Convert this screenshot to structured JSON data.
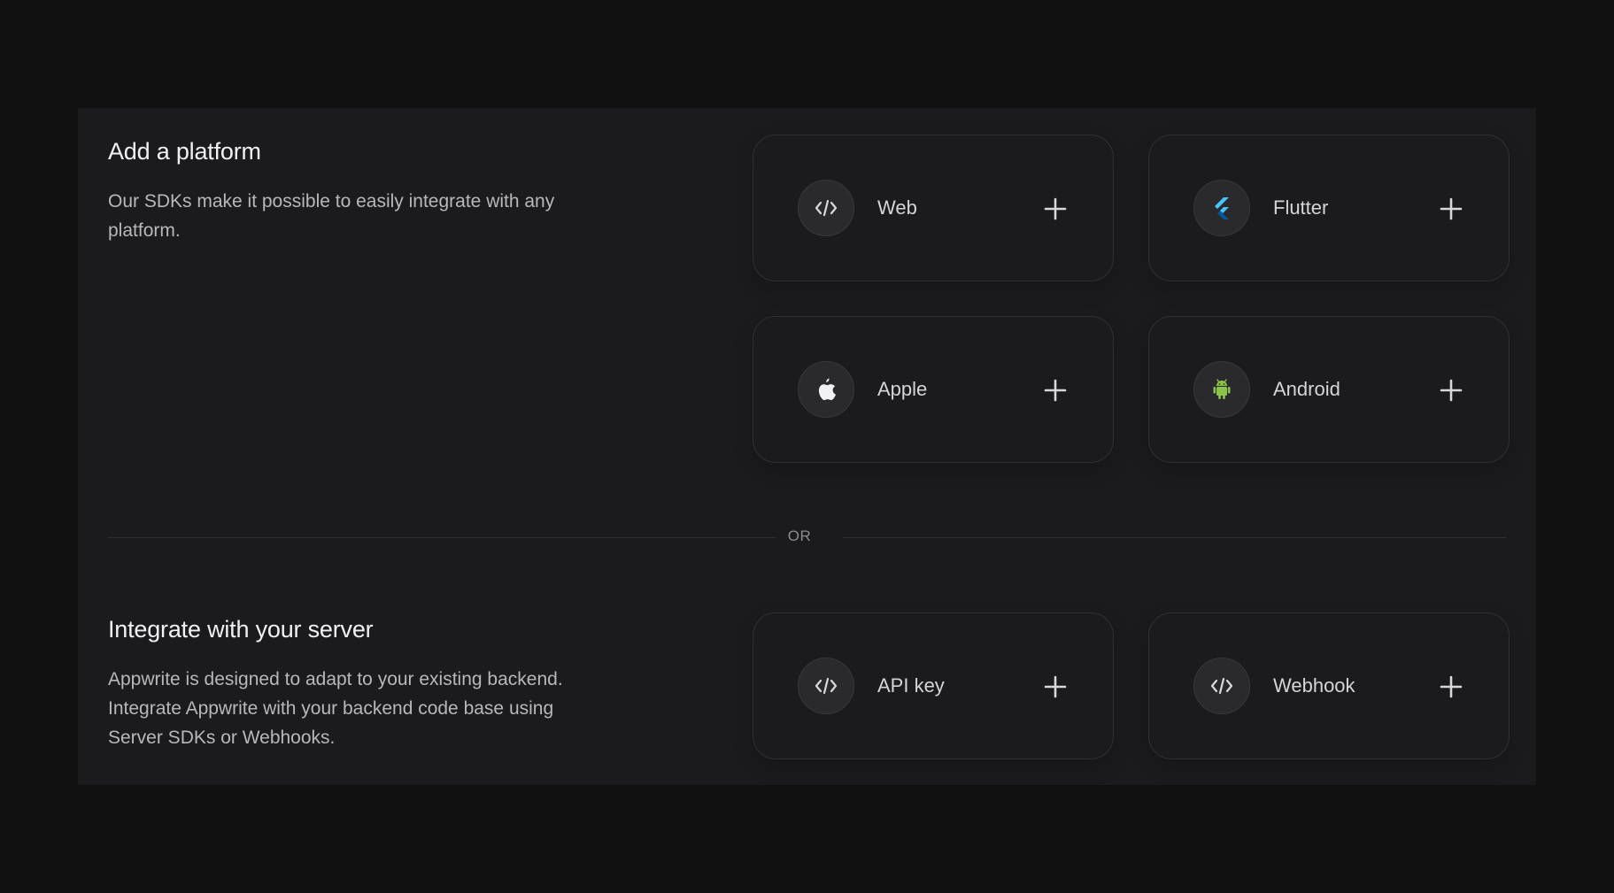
{
  "platform_section": {
    "title": "Add a platform",
    "description": "Our SDKs make it possible to easily integrate with any platform.",
    "cards": [
      {
        "label": "Web",
        "icon": "code-icon"
      },
      {
        "label": "Flutter",
        "icon": "flutter-icon",
        "icon_color": "#47c5fb"
      },
      {
        "label": "Apple",
        "icon": "apple-icon"
      },
      {
        "label": "Android",
        "icon": "android-icon",
        "icon_color": "#8bc34a"
      }
    ]
  },
  "divider": {
    "label": "OR"
  },
  "server_section": {
    "title": "Integrate with your server",
    "description": "Appwrite is designed to adapt to your existing backend. Integrate Appwrite with your backend code base using Server SDKs or Webhooks.",
    "cards": [
      {
        "label": "API key",
        "icon": "code-icon"
      },
      {
        "label": "Webhook",
        "icon": "code-icon"
      }
    ]
  },
  "colors": {
    "background": "#111111",
    "panel": "#1b1b1d",
    "card_border": "#303034",
    "text_primary": "#f1f1f3",
    "text_secondary": "#b7b7bd"
  }
}
